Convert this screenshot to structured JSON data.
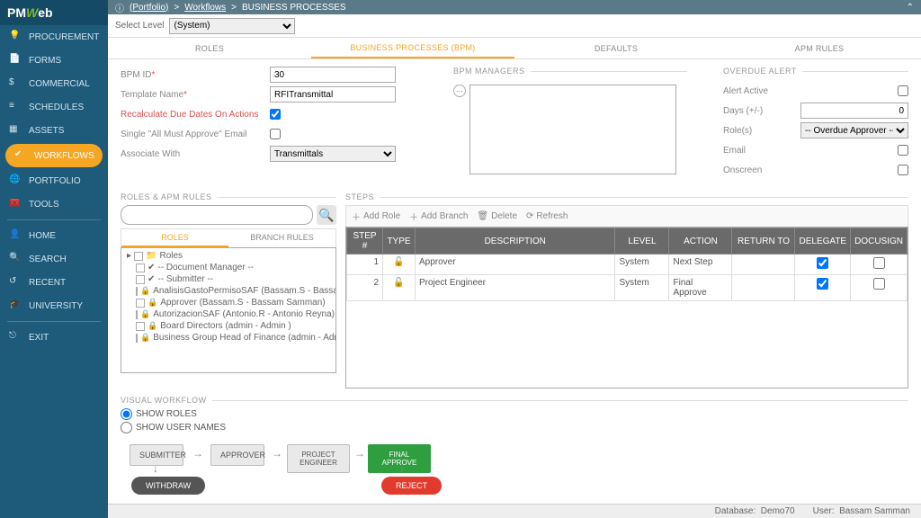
{
  "logo": {
    "pm": "PM",
    "w": "W",
    "eb": "eb"
  },
  "sidebar": {
    "items": [
      {
        "label": "PROCUREMENT"
      },
      {
        "label": "FORMS"
      },
      {
        "label": "COMMERCIAL"
      },
      {
        "label": "SCHEDULES"
      },
      {
        "label": "ASSETS"
      },
      {
        "label": "WORKFLOWS"
      },
      {
        "label": "PORTFOLIO"
      },
      {
        "label": "TOOLS"
      }
    ],
    "bottom": [
      {
        "label": "HOME"
      },
      {
        "label": "SEARCH"
      },
      {
        "label": "RECENT"
      },
      {
        "label": "UNIVERSITY"
      },
      {
        "label": "EXIT"
      }
    ]
  },
  "breadcrumb": {
    "portfolio": "(Portfolio)",
    "sep": ">",
    "wf": "Workflows",
    "bp": "BUSINESS PROCESSES"
  },
  "level": {
    "label": "Select Level",
    "value": "(System)"
  },
  "tabs": {
    "roles": "ROLES",
    "bpm": "BUSINESS PROCESSES (BPM)",
    "defaults": "DEFAULTS",
    "apm": "APM RULES"
  },
  "form": {
    "bpm_id_lbl": "BPM ID",
    "bpm_id_val": "30",
    "template_lbl": "Template Name",
    "template_val": "RFITransmittal",
    "recalc_lbl": "Recalculate Due Dates On Actions",
    "single_lbl": "Single \"All Must Approve\" Email",
    "assoc_lbl": "Associate With",
    "assoc_val": "Transmittals"
  },
  "managers_lbl": "BPM MANAGERS",
  "overdue": {
    "title": "OVERDUE ALERT",
    "active_lbl": "Alert Active",
    "days_lbl": "Days (+/-)",
    "days_val": "0",
    "roles_lbl": "Role(s)",
    "roles_val": "-- Overdue Approver --",
    "email_lbl": "Email",
    "onscreen_lbl": "Onscreen"
  },
  "sections": {
    "roles_apm": "ROLES & APM RULES",
    "steps": "STEPS",
    "visual": "VISUAL WORKFLOW"
  },
  "subtabs": {
    "roles": "ROLES",
    "branch": "BRANCH RULES"
  },
  "tree": {
    "root": "Roles",
    "items": [
      "-- Document Manager --",
      "-- Submitter --",
      "AnalisisGastoPermisoSAF (Bassam.S - Bassam Sam",
      "Approver (Bassam.S - Bassam Samman)",
      "AutorizacionSAF (Antonio.R - Antonio Reyna)",
      "Board Directors (admin - Admin )",
      "Business Group Head of Finance (admin - Admin )"
    ]
  },
  "steps_toolbar": {
    "add_role": "Add Role",
    "add_branch": "Add Branch",
    "delete": "Delete",
    "refresh": "Refresh"
  },
  "steps_header": {
    "num": "STEP #",
    "type": "TYPE",
    "desc": "DESCRIPTION",
    "level": "LEVEL",
    "action": "ACTION",
    "return": "RETURN TO",
    "delegate": "DELEGATE",
    "docusign": "DOCUSIGN"
  },
  "steps_rows": [
    {
      "num": "1",
      "desc": "Approver",
      "level": "System",
      "action": "Next Step",
      "delegate": true,
      "docusign": false
    },
    {
      "num": "2",
      "desc": "Project Engineer",
      "level": "System",
      "action": "Final Approve",
      "delegate": true,
      "docusign": false
    }
  ],
  "visual": {
    "show_roles": "SHOW ROLES",
    "show_users": "SHOW USER NAMES",
    "boxes": {
      "submitter": "SUBMITTER",
      "approver": "APPROVER",
      "pe": "PROJECT ENGINEER",
      "final": "FINAL APPROVE",
      "withdraw": "WITHDRAW",
      "reject": "REJECT"
    }
  },
  "status": {
    "db_lbl": "Database:",
    "db_val": "Demo70",
    "user_lbl": "User:",
    "user_val": "Bassam Samman"
  }
}
